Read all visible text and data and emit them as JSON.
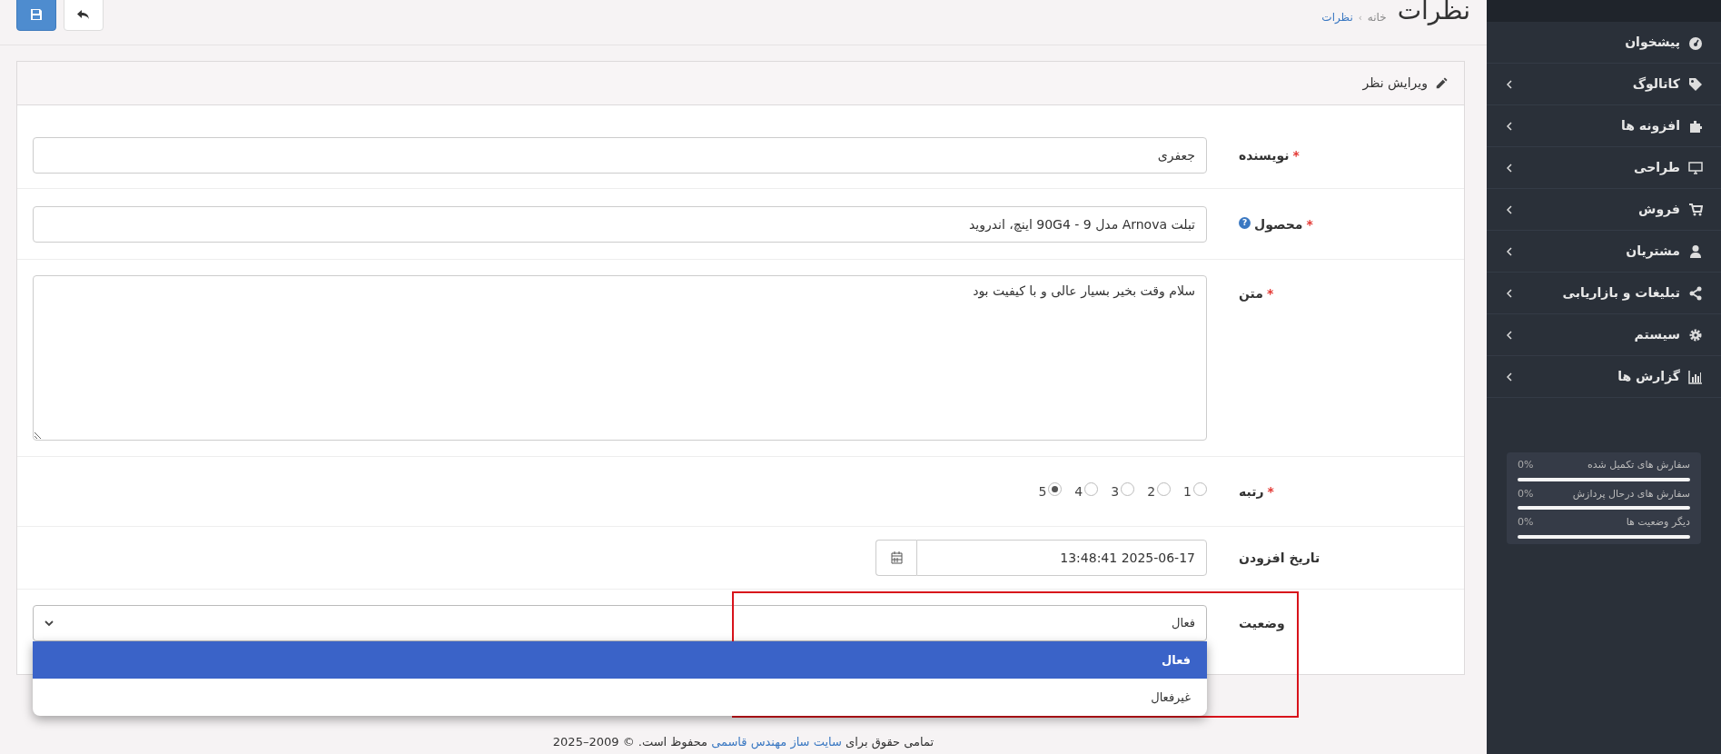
{
  "page_header": {
    "title": "نظرات",
    "separator": "›",
    "breadcrumb": [
      {
        "label": "خانه",
        "link": false
      },
      {
        "label": "نظرات",
        "link": true
      }
    ]
  },
  "toolbar": {
    "buttons": [
      {
        "kind": "back"
      },
      {
        "kind": "save"
      }
    ]
  },
  "panel": {
    "title": "ویرایش نظر"
  },
  "form": {
    "fields": [
      {
        "kind": "text",
        "label": "نویسنده",
        "required_mark": "*",
        "value": "جعفری"
      },
      {
        "kind": "text",
        "label": "محصول",
        "required_mark": "*",
        "help": "?",
        "value": "تبلت Arnova مدل 9 - 90G4 اینچ، اندروید"
      },
      {
        "kind": "textarea",
        "label": "متن",
        "required_mark": "*",
        "value": "سلام وقت بخیر بسیار عالی و با کیفیت بود"
      },
      {
        "kind": "radio",
        "label": "رتبه",
        "required_mark": "*",
        "options": [
          {
            "label": "1",
            "selected": false
          },
          {
            "label": "2",
            "selected": false
          },
          {
            "label": "3",
            "selected": false
          },
          {
            "label": "4",
            "selected": false
          },
          {
            "label": "5",
            "selected": true
          }
        ]
      },
      {
        "kind": "datetime",
        "label": "تاریخ افزودن",
        "value": "2025-06-17 13:48:41"
      },
      {
        "kind": "select",
        "label": "وضعیت",
        "value": "فعال",
        "expanded": true,
        "options": [
          {
            "label": "فعال",
            "selected": true
          },
          {
            "label": "غیرفعال",
            "selected": false
          }
        ]
      }
    ]
  },
  "footer": {
    "before": "تمامی حقوق برای ",
    "link": "سایت ساز مهندس قاسمی",
    "after": " محفوظ است. © 2009–2025"
  },
  "sidebar": {
    "menu": [
      {
        "label": "پیشخوان",
        "expandable": false
      },
      {
        "label": "کاتالوگ",
        "expandable": true
      },
      {
        "label": "افزونه ها",
        "expandable": true
      },
      {
        "label": "طراحی",
        "expandable": true
      },
      {
        "label": "فروش",
        "expandable": true
      },
      {
        "label": "مشتریان",
        "expandable": true
      },
      {
        "label": "تبلیغات و بازاریابی",
        "expandable": true
      },
      {
        "label": "سیستم",
        "expandable": true
      },
      {
        "label": "گزارش ها",
        "expandable": true
      }
    ],
    "stats": [
      {
        "label": "سفارش های تکمیل شده",
        "reading": "0%",
        "level": 0
      },
      {
        "label": "سفارش های درحال پردازش",
        "reading": "0%",
        "level": 0
      },
      {
        "label": "دیگر وضعیت ها",
        "reading": "0%",
        "level": 0
      }
    ]
  }
}
